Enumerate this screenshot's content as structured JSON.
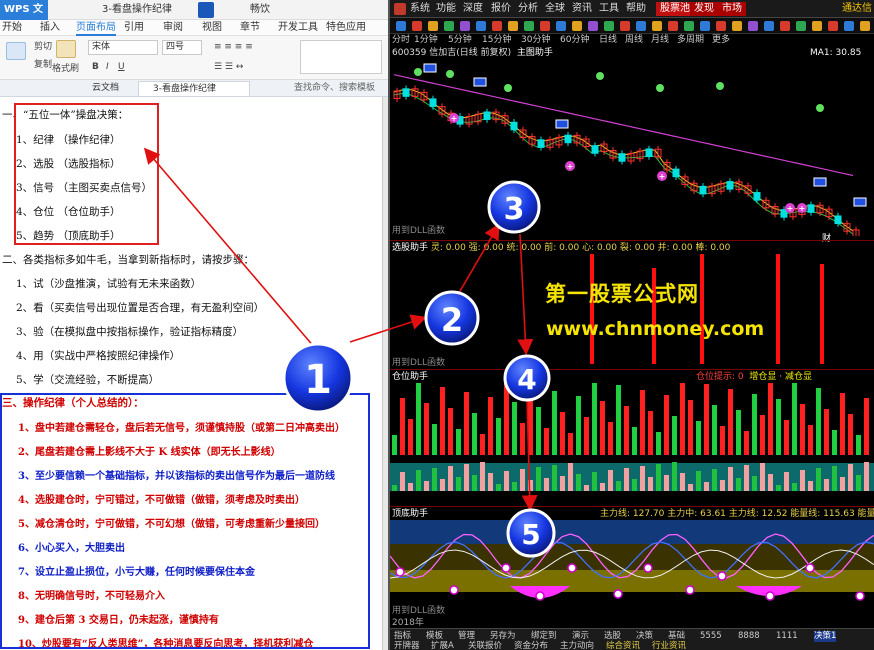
{
  "wps": {
    "app_title": "WPS 文字",
    "window_tabs": [
      "3-看盘操作纪律",
      "畅饮"
    ],
    "menus": [
      "开始",
      "插入",
      "页面布局",
      "引用",
      "审阅",
      "视图",
      "章节",
      "开发工具",
      "特色应用"
    ],
    "active_menu": "页面布局",
    "ribbon": {
      "cut": "剪切",
      "copy": "复制",
      "format_painter": "格式刷",
      "font_name": "宋体",
      "font_size": "四号"
    },
    "doc_tabs": [
      "云文档",
      "3-看盘操作纪律"
    ],
    "search_placeholder": "查找命令、搜索模板"
  },
  "doc": {
    "heading1": "一、“五位一体”操盘决策：",
    "list1": [
      "1、纪律 （操作纪律）",
      "2、选股 （选股指标）",
      "3、信号 （主图买卖点信号）",
      "4、仓位 （仓位助手）",
      "5、趋势 （顶底助手）"
    ],
    "heading2": "二、各类指标多如牛毛，当拿到新指标时，请按步骤：",
    "list2": [
      "1、试（沙盘推演，试验有无未来函数）",
      "2、看（买卖信号出现位置是否合理，有无盈利空间）",
      "3、验（在模拟盘中按指标操作，验证指标精度）",
      "4、用（实战中严格按照纪律操作）",
      "5、学（交流经验，不断提高）"
    ],
    "heading3": "三、操作纪律（个人总结的）：",
    "rules": [
      {
        "text": "1、盘中若建仓需轻仓，盘后若无信号，须谨慎持股（或第二日冲高卖出）",
        "color": "red"
      },
      {
        "text": "2、尾盘若建仓需上影线不大于 K 线实体（即无长上影线）",
        "color": "red"
      },
      {
        "text": "3、至少要信赖一个基础指标，并以该指标的卖出信号作为最后一道防线",
        "color": "blue"
      },
      {
        "text": "4、选股建仓时，宁可错过，不可做错（做错，须考虑及时卖出）",
        "color": "red"
      },
      {
        "text": "5、减仓清仓时，宁可做错，不可幻想（做错，可考虑重新少量接回）",
        "color": "red"
      },
      {
        "text": "6、小心买入，大胆卖出",
        "color": "blue"
      },
      {
        "text": "7、设立止盈止损位，小亏大赚，任何时候要保住本金",
        "color": "blue"
      },
      {
        "text": "8、无明确信号时，不可轻易介入",
        "color": "red"
      },
      {
        "text": "9、建仓后第 3 交易日，仍未起涨，谨慎持有",
        "color": "red"
      },
      {
        "text": "10、炒股要有“反人类思维”，各种消息要反向思考，择机获利减仓",
        "color": "red"
      }
    ]
  },
  "stock": {
    "menus": [
      "系统",
      "功能",
      "深度",
      "报价",
      "分析",
      "全球",
      "资讯",
      "工具",
      "帮助"
    ],
    "buttons": [
      "股票池",
      "发现",
      "市场"
    ],
    "right_label": "通达信金",
    "periods": [
      "分时",
      "1分钟",
      "5分钟",
      "15分钟",
      "30分钟",
      "60分钟",
      "日线",
      "周线",
      "月线",
      "多周期",
      "更多"
    ],
    "main_title": "600359 信加吉(日线 前复权)",
    "main_panel": "主图助手",
    "ma_label": "MA1: 30.85",
    "dll_label": "用到DLL函数",
    "xuangu_title": "选股助手",
    "xuangu_vals": "灵: 0.00  强: 0.00  统: 0.00  前: 0.00  心: 0.00  裂: 0.00  并: 0.00  棒: 0.00",
    "cangwei_title": "仓位助手",
    "cangwei_vals": [
      "仓位提示: 0",
      "增仓显",
      "减仓显"
    ],
    "dingdi_title": "顶底助手",
    "dingdi_vals": "主力线: 127.70  主力中: 63.61  主力线: 12.52   能量线: 115.63  能量中: 48.15",
    "year_label": "2018年",
    "finance_label": "财",
    "bottom_tabs": [
      "指标",
      "模板",
      "管理",
      "另存为",
      "绑定到",
      "演示",
      "选股",
      "决策",
      "基础",
      "5555",
      "8888",
      "1111",
      "决策1"
    ],
    "bottom_row2": [
      "开牌器",
      "扩展A",
      "关联报价",
      "资金分布",
      "主力动向",
      "综合资讯",
      "行业资讯"
    ],
    "active_bottom_tab": "决策1"
  },
  "annotations": {
    "watermark_cn": "第一股票公式网",
    "watermark_url": "www.chnmoney.com",
    "circles": [
      "1",
      "2",
      "3",
      "4",
      "5"
    ]
  },
  "colors": {
    "red_box": "#e02020",
    "blue_box": "#1830d8",
    "watermark": "#f5e400",
    "circle": "#1536e0"
  }
}
